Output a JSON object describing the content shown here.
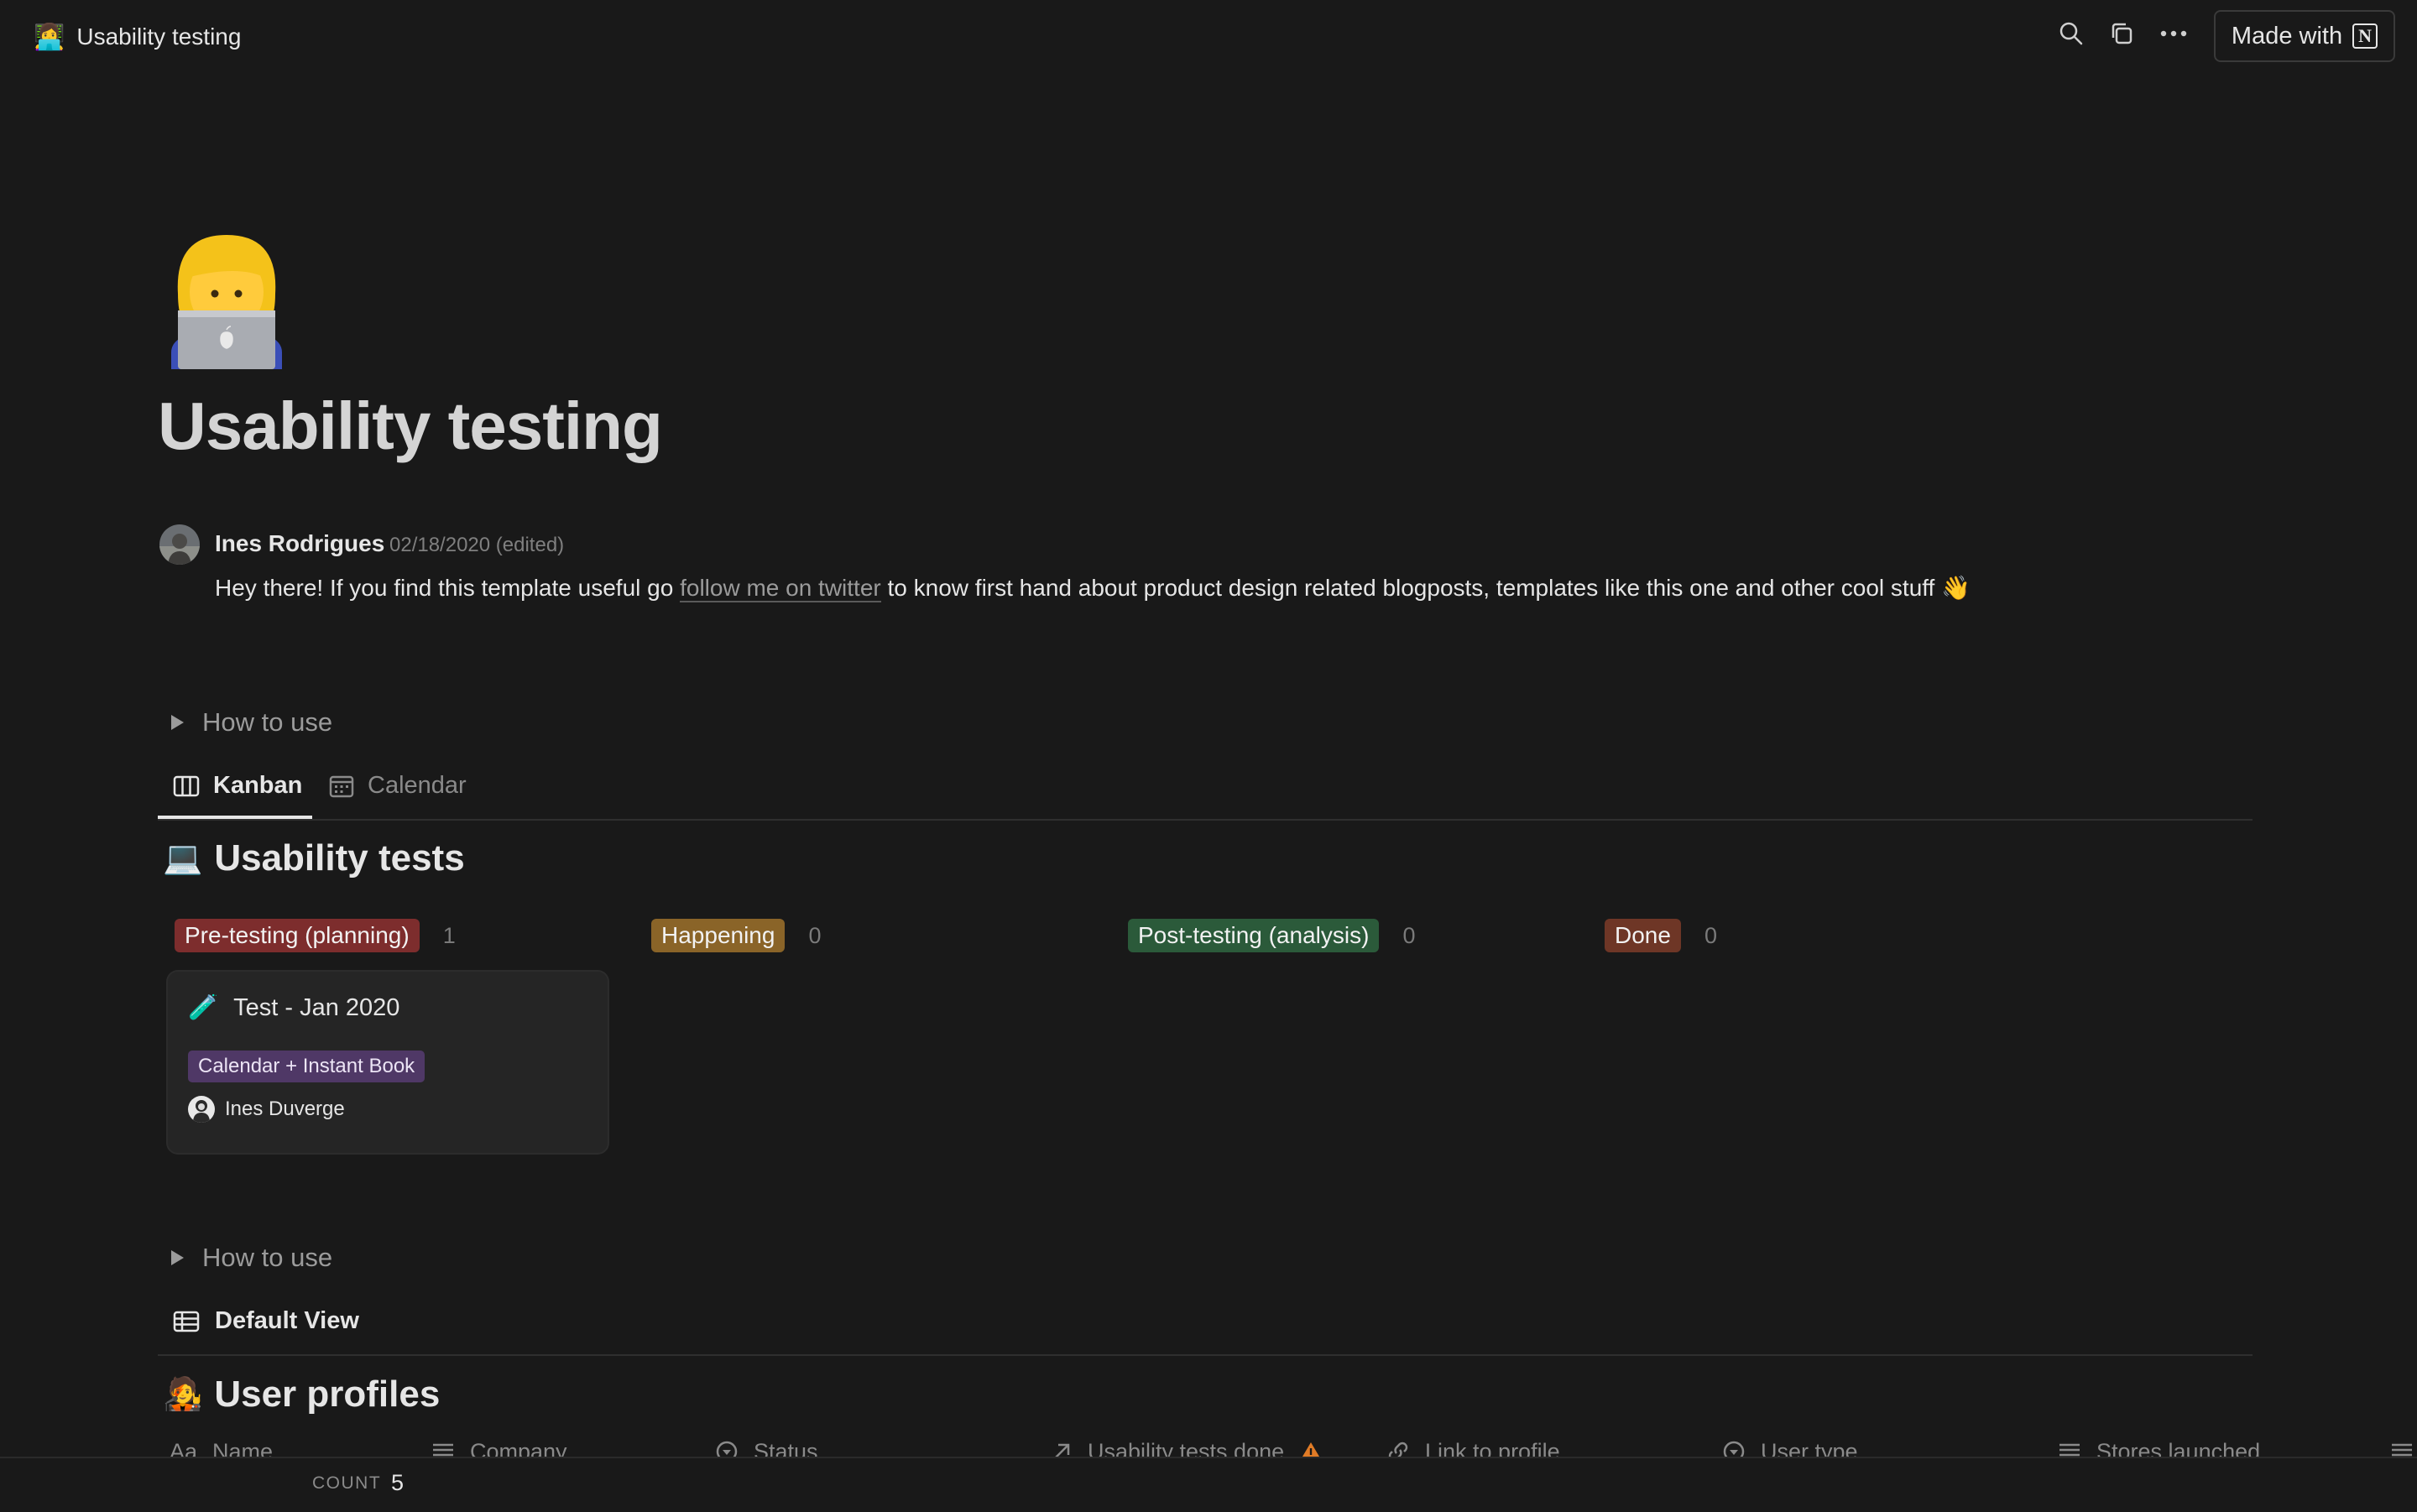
{
  "topbar": {
    "emoji": "👩‍💻",
    "title": "Usability testing",
    "made_with_label": "Made with",
    "notion_mark": "N",
    "icons": [
      "search-icon",
      "duplicate-icon",
      "more-icon"
    ]
  },
  "page": {
    "icon_emoji": "👩‍💻",
    "title": "Usability testing"
  },
  "comment": {
    "author": "Ines Rodrigues",
    "date": "02/18/2020 (edited)",
    "text_before": "Hey there! If you find this template useful go ",
    "link_text": "follow me on twitter",
    "text_after": " to know first hand about product design related blogposts, templates like this one and other cool stuff 👋"
  },
  "toggle_1": {
    "label": "How to use"
  },
  "views": {
    "tabs": [
      {
        "label": "Kanban",
        "active": true,
        "icon": "board-icon"
      },
      {
        "label": "Calendar",
        "active": false,
        "icon": "calendar-icon"
      }
    ]
  },
  "board": {
    "emoji": "💻",
    "title": "Usability tests",
    "columns": [
      {
        "label": "Pre-testing (planning)",
        "count": "1",
        "color": "#7d2d2d"
      },
      {
        "label": "Happening",
        "count": "0",
        "color": "#8a6428"
      },
      {
        "label": "Post-testing (analysis)",
        "count": "0",
        "color": "#2b5a3a"
      },
      {
        "label": "Done",
        "count": "0",
        "color": "#6e3626"
      }
    ],
    "card": {
      "emoji": "🧪",
      "title": "Test - Jan 2020",
      "tag": "Calendar + Instant Book",
      "person": "Ines Duverge"
    }
  },
  "toggle_2": {
    "label": "How to use"
  },
  "default_view": {
    "label": "Default View"
  },
  "profiles": {
    "emoji": "🧑‍🎤",
    "title": "User profiles",
    "columns": [
      {
        "label": "Name",
        "icon": "Aa"
      },
      {
        "label": "Company",
        "icon": "text-icon"
      },
      {
        "label": "Status",
        "icon": "select-icon"
      },
      {
        "label": "Usability tests done",
        "icon": "relation-icon",
        "warning": true
      },
      {
        "label": "Link to profile",
        "icon": "link-icon"
      },
      {
        "label": "User type",
        "icon": "select-icon"
      },
      {
        "label": "Stores launched",
        "icon": "text-icon"
      }
    ]
  },
  "footer": {
    "count_label": "COUNT",
    "count_value": "5"
  },
  "colors": {
    "background": "#191919",
    "tag_purple": "#4f3866",
    "warning": "#e07b26"
  }
}
